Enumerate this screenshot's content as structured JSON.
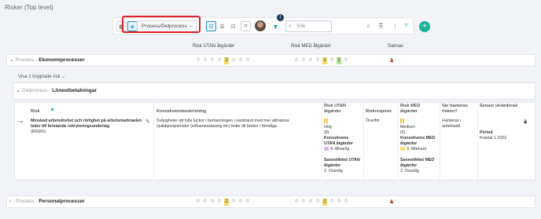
{
  "page": {
    "title": "Risker (Top level)"
  },
  "toolbar": {
    "view_select": "Process/Delprocess",
    "search_placeholder": "Sök",
    "filter_count": "1",
    "add_label": "+"
  },
  "columns": {
    "without": "Risk UTAN åtgärder",
    "with": "Risk MED åtgärder",
    "missing": "Saknas"
  },
  "groups": [
    {
      "prefix": "Process -",
      "name": "Ekonomiprocesser",
      "without": [
        "0",
        "0",
        "0",
        "0",
        "2",
        "0",
        "0",
        "0"
      ],
      "with": [
        "0",
        "0",
        "0",
        "0",
        "1",
        "0",
        "1",
        "0"
      ]
    },
    {
      "prefix": "Delprocess -",
      "name": "Löneutbetalningar"
    },
    {
      "prefix": "Process -",
      "name": "Personalprocesser",
      "without": [
        "0",
        "0",
        "0",
        "0",
        "2",
        "0",
        "0",
        "0"
      ],
      "with": [
        "0",
        "0",
        "0",
        "0",
        "2",
        "0",
        "0",
        "0"
      ]
    }
  ],
  "linked_risk": "Visa 1 kopplade risk",
  "detail": {
    "headers": {
      "risk": "Risk",
      "desc": "Konsekvensbeskrivning",
      "without": "Risk UTAN åtgärder",
      "response": "Riskrespons",
      "with": "Risk MED åtgärder",
      "handled": "Var hanteras risken?",
      "updated": "Senast utvärderad"
    },
    "risk_title": "Minskad arbetslöshet och rörlighet på arbetsmarknaden leder till bristande rekryteringsunderlag",
    "risk_id": "(RISK6)",
    "description": "Svårigheter att fylla luckor i bemanningen i samband med mer allmänna sjukdomsperioder (influensasäsong etc) leder till brister i förmåga",
    "without": {
      "level": "Hög",
      "score": "(8)",
      "cons_label": "Konsekvens UTAN åtgärder",
      "cons_value": "4. Allvarlig",
      "prob_label": "Sannolikhet UTAN åtgärder",
      "prob_value": "2. Ovanlig"
    },
    "response": "Överför",
    "with": {
      "level": "Medium",
      "score": "(6)",
      "cons_label": "Konsekvens MED åtgärder",
      "cons_value": "3. Märkant",
      "prob_label": "Sannolikhet MED åtgärder",
      "prob_value": "2. Ovanlig"
    },
    "handled": "Hanteras i arbetssätt",
    "period_label": "Period",
    "period_value": "Kvartal 1 2022"
  }
}
